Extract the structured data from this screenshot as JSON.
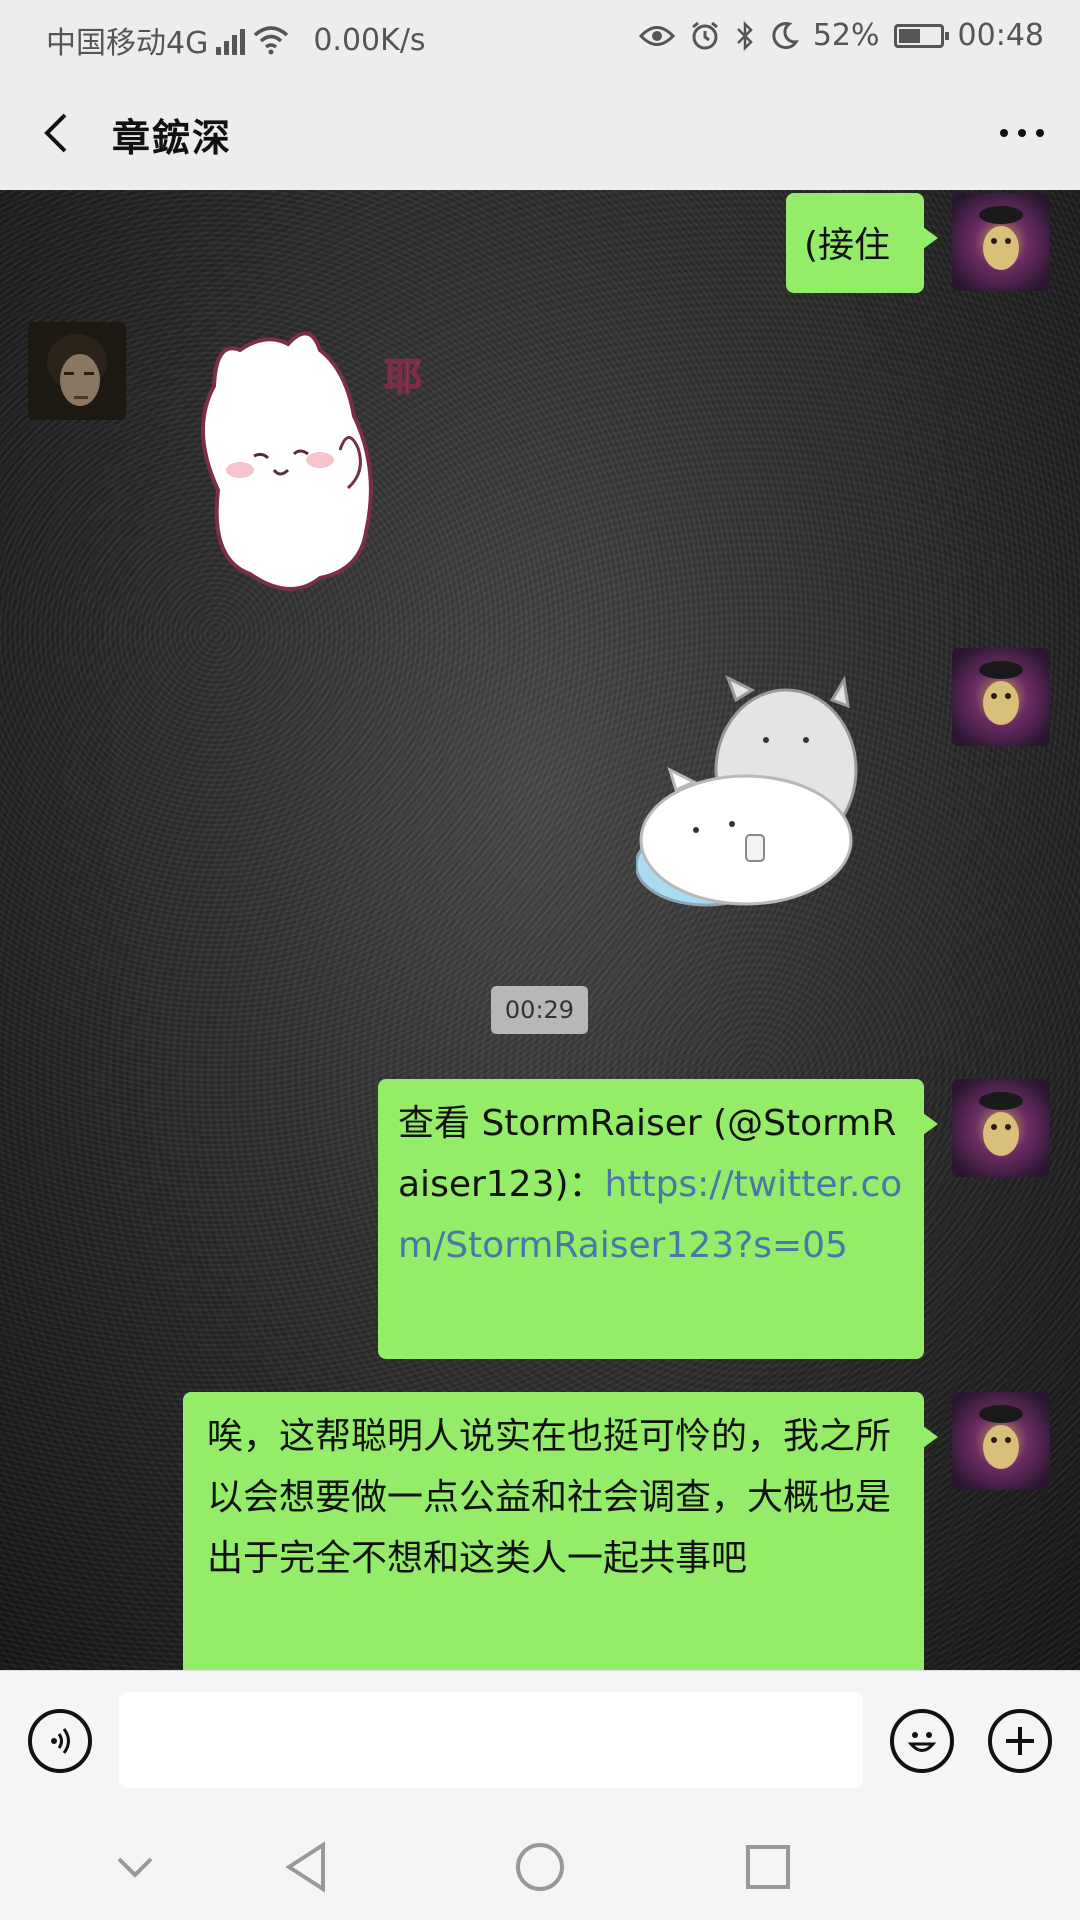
{
  "status_bar": {
    "carrier": "中国移动4G",
    "network_badge": "4G",
    "speed": "0.00K/s",
    "battery": "52%",
    "battery_level": 0.52,
    "time": "00:48",
    "icons": [
      "signal-icon",
      "wifi-icon",
      "eye-icon",
      "alarm-icon",
      "bluetooth-icon",
      "moon-icon",
      "battery-icon"
    ]
  },
  "header": {
    "title": "章鋐深",
    "back_icon": "chevron-left-icon",
    "more_icon": "more-dots-icon"
  },
  "messages": [
    {
      "side": "right",
      "type": "text",
      "text": "(接住"
    },
    {
      "side": "left",
      "type": "sticker",
      "sticker_text": "耶"
    },
    {
      "side": "right",
      "type": "sticker"
    },
    {
      "type": "time",
      "text": "00:29"
    },
    {
      "side": "right",
      "type": "text",
      "text": "查看 StormRaiser (@StormRaiser123)：",
      "link": "https://twitter.com/StormRaiser123?s=05"
    },
    {
      "side": "right",
      "type": "text",
      "text": "唉，这帮聪明人说实在也挺可怜的，我之所以会想要做一点公益和社会调查，大概也是出于完全不想和这类人一起共事吧"
    }
  ],
  "input_bar": {
    "placeholder": "",
    "value": "",
    "voice_icon": "voice-icon",
    "emoji_icon": "emoji-icon",
    "plus_icon": "plus-icon"
  },
  "nav_bar": {
    "icons": [
      "chevron-down-icon",
      "back-triangle-icon",
      "home-circle-icon",
      "recents-square-icon"
    ]
  },
  "colors": {
    "bubble": "#95ec69",
    "link": "#4a76a8",
    "bar": "#ededed"
  }
}
